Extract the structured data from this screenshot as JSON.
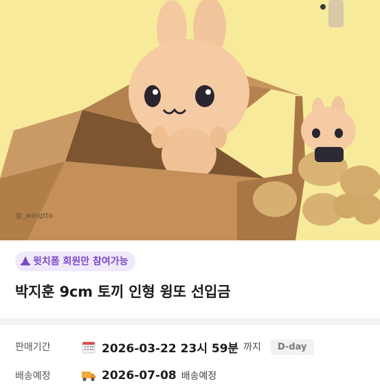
{
  "hero": {
    "watermark": "@_wingtto"
  },
  "badge": {
    "icon": "witch-hat-icon",
    "label": "윗치폼 회원만 참여가능",
    "color": "#7b49c9"
  },
  "product": {
    "title": "박지훈 9cm 토끼 인형 윙또 선입금"
  },
  "sale_period": {
    "label": "판매기간",
    "icon": "calendar-icon",
    "value": "2026-03-22 23시 59분",
    "suffix": "까지",
    "badge": "D-day"
  },
  "shipping": {
    "label": "배송예정",
    "icon": "truck-icon",
    "value": "2026-07-08",
    "suffix": "배송예정"
  }
}
